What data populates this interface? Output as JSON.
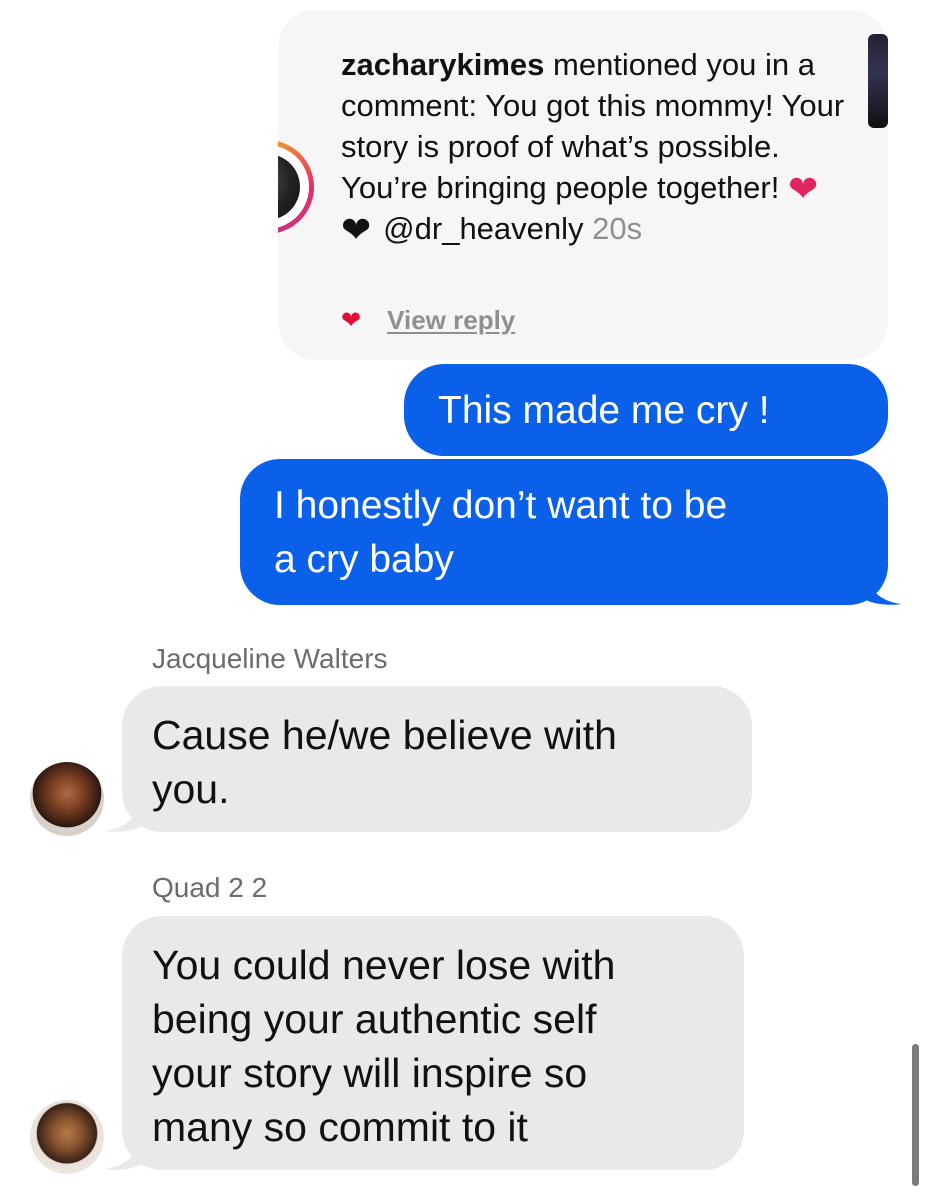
{
  "shared_post": {
    "username": "zacharykimes",
    "text": "mentioned you in a comment: You got this mommy! Your story is proof of what’s possible. You’re bringing people together!",
    "handle": "@dr_heavenly",
    "time": "20s",
    "view_reply": "View reply",
    "red_heart_icon": "red-heart",
    "black_heart_icon": "black-heart"
  },
  "messages": [
    {
      "direction": "outgoing",
      "text": "This made me cry !"
    },
    {
      "direction": "outgoing",
      "text_lines": [
        "I honestly don’t want to be",
        "a cry baby"
      ]
    },
    {
      "direction": "incoming",
      "sender": "Jacqueline Walters",
      "text_lines": [
        "Cause he/we believe  with",
        "you."
      ]
    },
    {
      "direction": "incoming",
      "sender": "Quad 2 2",
      "text_lines": [
        "You could never lose with",
        "being your authentic self",
        "your story will inspire so",
        "many so commit to it"
      ]
    }
  ],
  "colors": {
    "outgoing_bubble": "#0a60e8",
    "incoming_bubble": "#e9e9eb",
    "card_background": "#f6f6f6",
    "meta_text": "#8e8e93"
  }
}
